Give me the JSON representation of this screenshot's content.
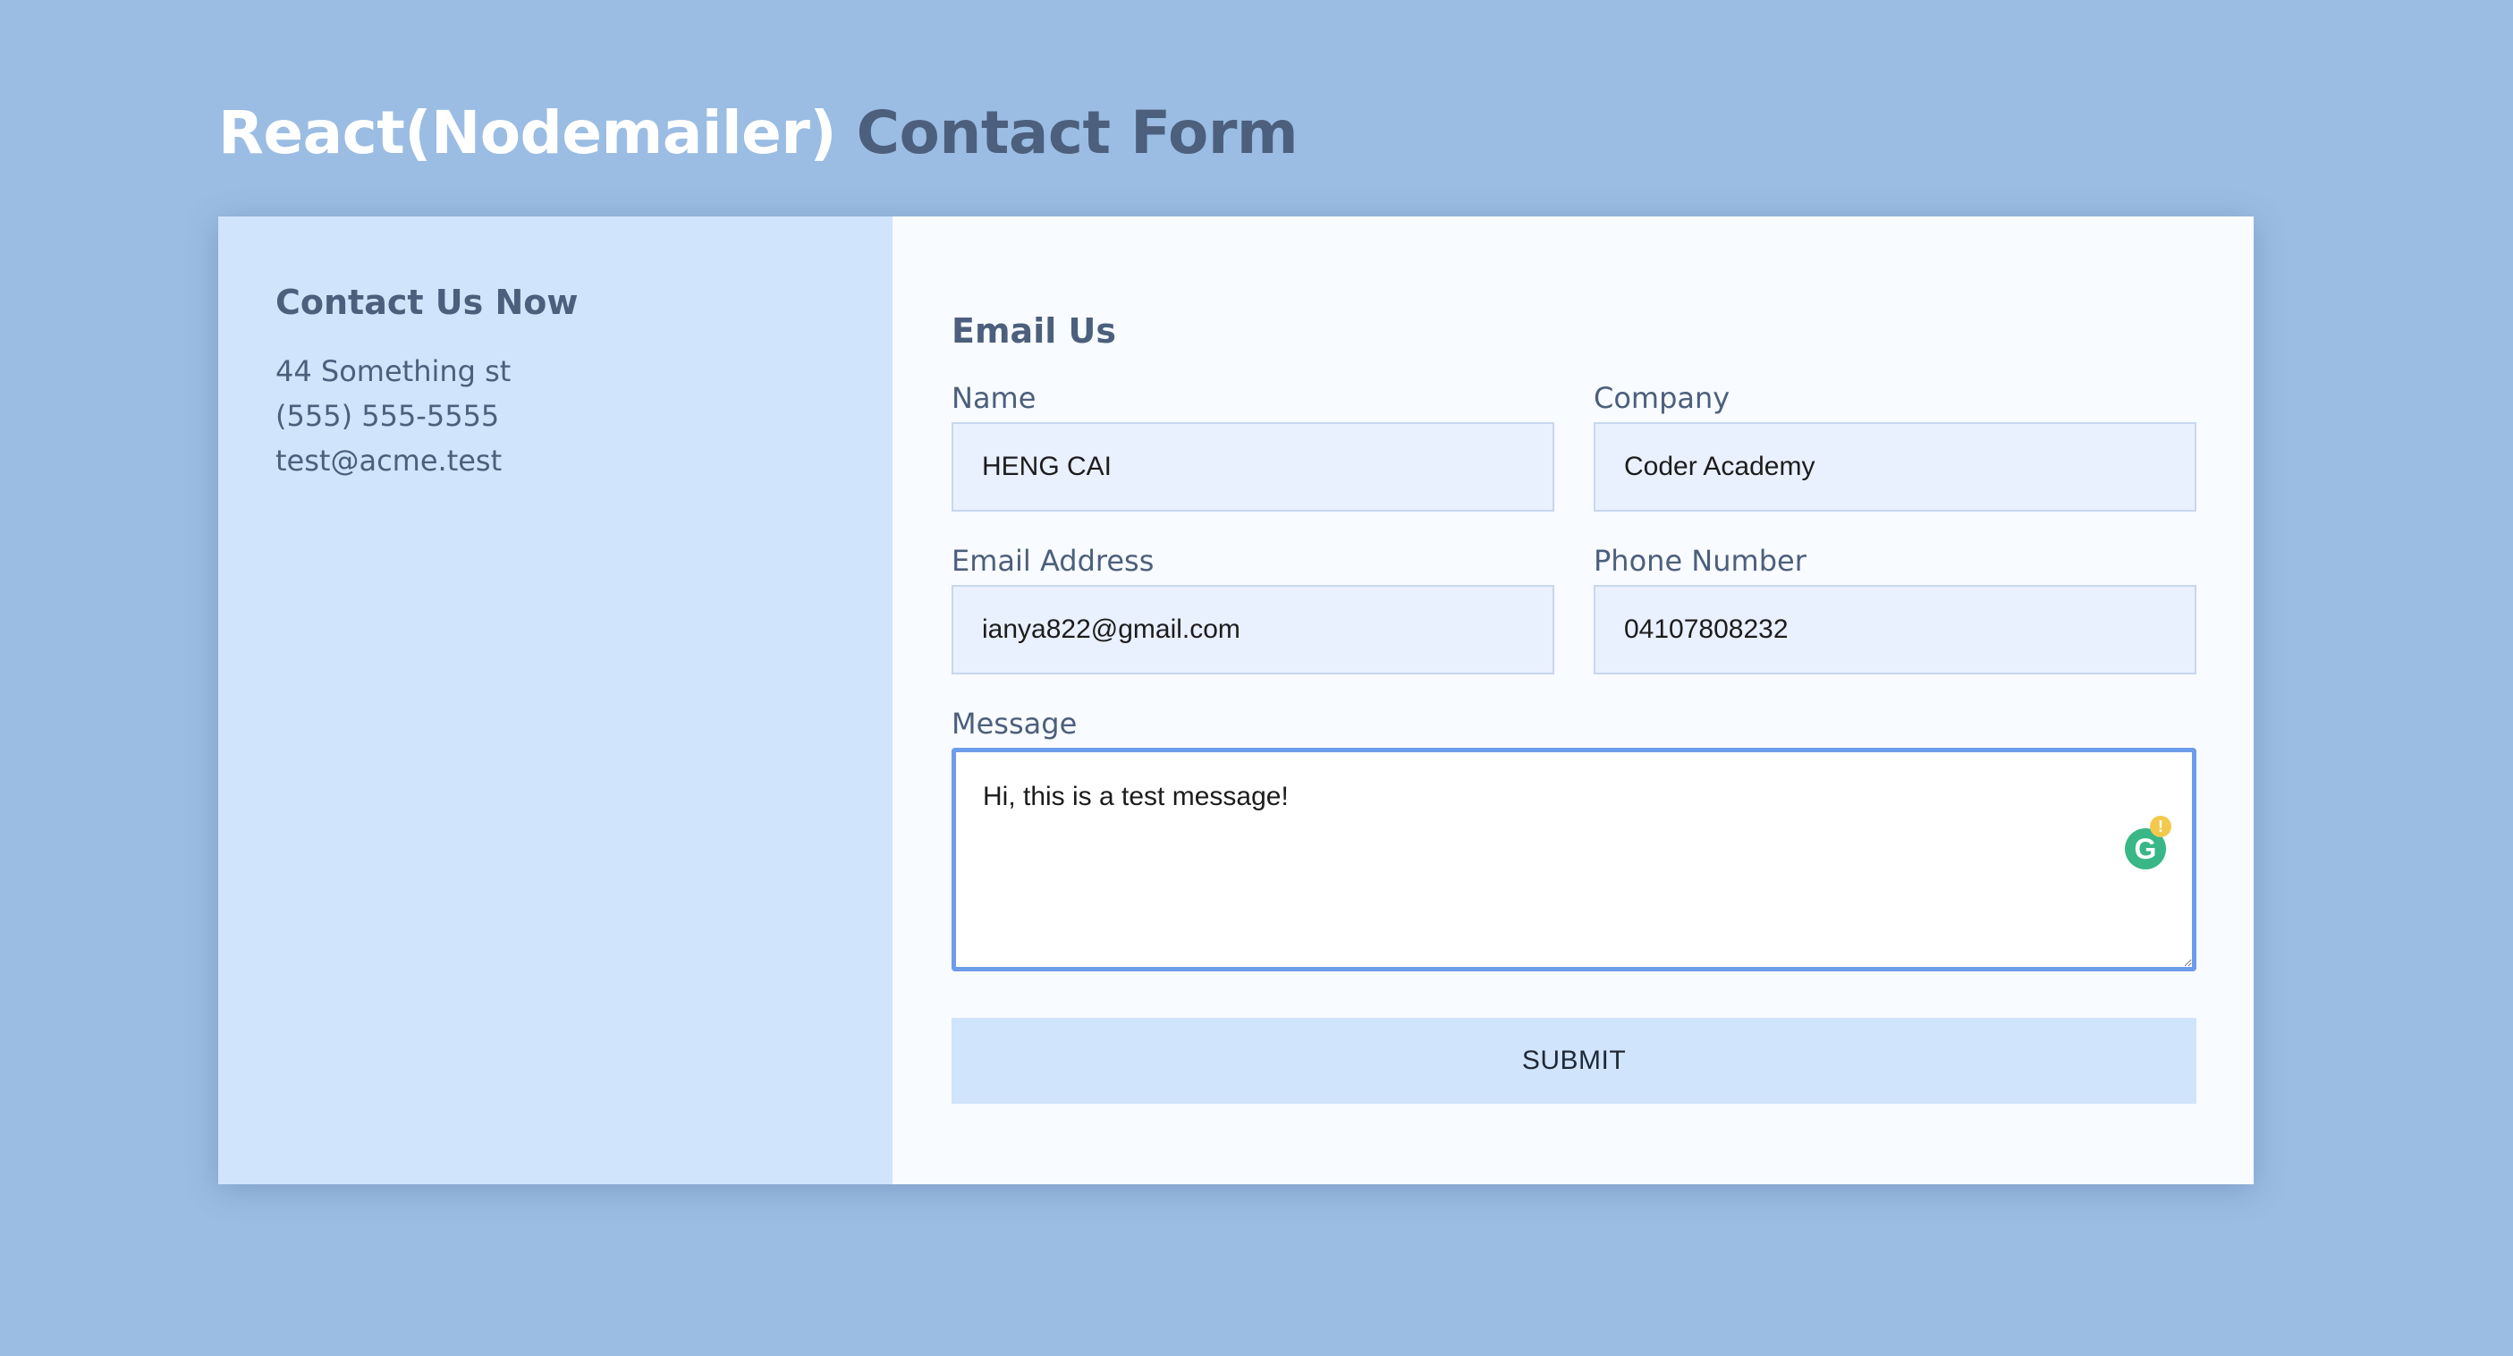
{
  "header": {
    "title_primary": "React(Nodemailer)",
    "title_secondary": "Contact Form"
  },
  "contact_panel": {
    "heading": "Contact Us Now",
    "address": "44 Something st",
    "phone": "(555) 555-5555",
    "email": "test@acme.test"
  },
  "form": {
    "heading": "Email Us",
    "name_label": "Name",
    "name_value": "HENG CAI",
    "company_label": "Company",
    "company_value": "Coder Academy",
    "email_label": "Email Address",
    "email_value": "ianya822@gmail.com",
    "phone_label": "Phone Number",
    "phone_value": "04107808232",
    "message_label": "Message",
    "message_value": "Hi, this is a test message!",
    "submit_label": "SUBMIT"
  },
  "icons": {
    "grammar_checker": "grammarly-icon",
    "grammar_letter": "G",
    "grammar_alert": "!"
  },
  "colors": {
    "background": "#9bbde3",
    "title_primary": "#ffffff",
    "title_secondary": "#4c5f7c",
    "contact_panel_bg": "#d0e4fb",
    "form_panel_bg": "#f8fbff",
    "input_bg": "#e9f0fe",
    "focus_border": "#6d9cea",
    "grammar_green": "#39b786",
    "grammar_alert": "#f2c94c"
  }
}
